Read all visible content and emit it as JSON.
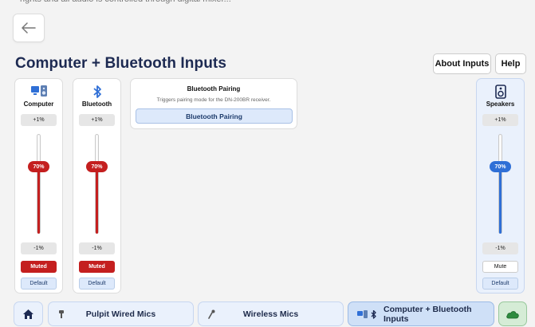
{
  "header": {
    "title": "Computer + Bluetooth Inputs",
    "about_label": "About Inputs",
    "help_label": "Help"
  },
  "strips": [
    {
      "name": "Computer",
      "up_label": "+1%",
      "level_label": "70%",
      "level": 0.7,
      "down_label": "-1%",
      "mute_label": "Muted",
      "muted": true,
      "default_label": "Default",
      "icon": "computer-speaker-icon"
    },
    {
      "name": "Bluetooth",
      "up_label": "+1%",
      "level_label": "70%",
      "level": 0.7,
      "down_label": "-1%",
      "mute_label": "Muted",
      "muted": true,
      "default_label": "Default",
      "icon": "bluetooth-icon"
    },
    {
      "name": "Speakers",
      "up_label": "+1%",
      "level_label": "70%",
      "level": 0.7,
      "down_label": "-1%",
      "mute_label": "Mute",
      "muted": false,
      "default_label": "Default",
      "icon": "speaker-icon"
    }
  ],
  "pairing": {
    "title": "Bluetooth Pairing",
    "description": "Triggers pairing mode for the DN-200BR receiver.",
    "button_label": "Bluetooth Pairing"
  },
  "nav": {
    "items": [
      {
        "label": "Pulpit Wired Mics",
        "icon": "mic-icon"
      },
      {
        "label": "Wireless Mics",
        "icon": "wireless-mic-icon"
      },
      {
        "label": "Computer + Bluetooth Inputs",
        "icon": "computer-bluetooth-icon",
        "active": true
      }
    ]
  },
  "colors": {
    "accent_blue": "#2f6fd6",
    "muted_red": "#c41f1f",
    "title_navy": "#1d2a52",
    "panel_blue": "#eaf1fc",
    "nav_active": "#cfe0f7",
    "cloud_green": "#2e8b3f"
  }
}
